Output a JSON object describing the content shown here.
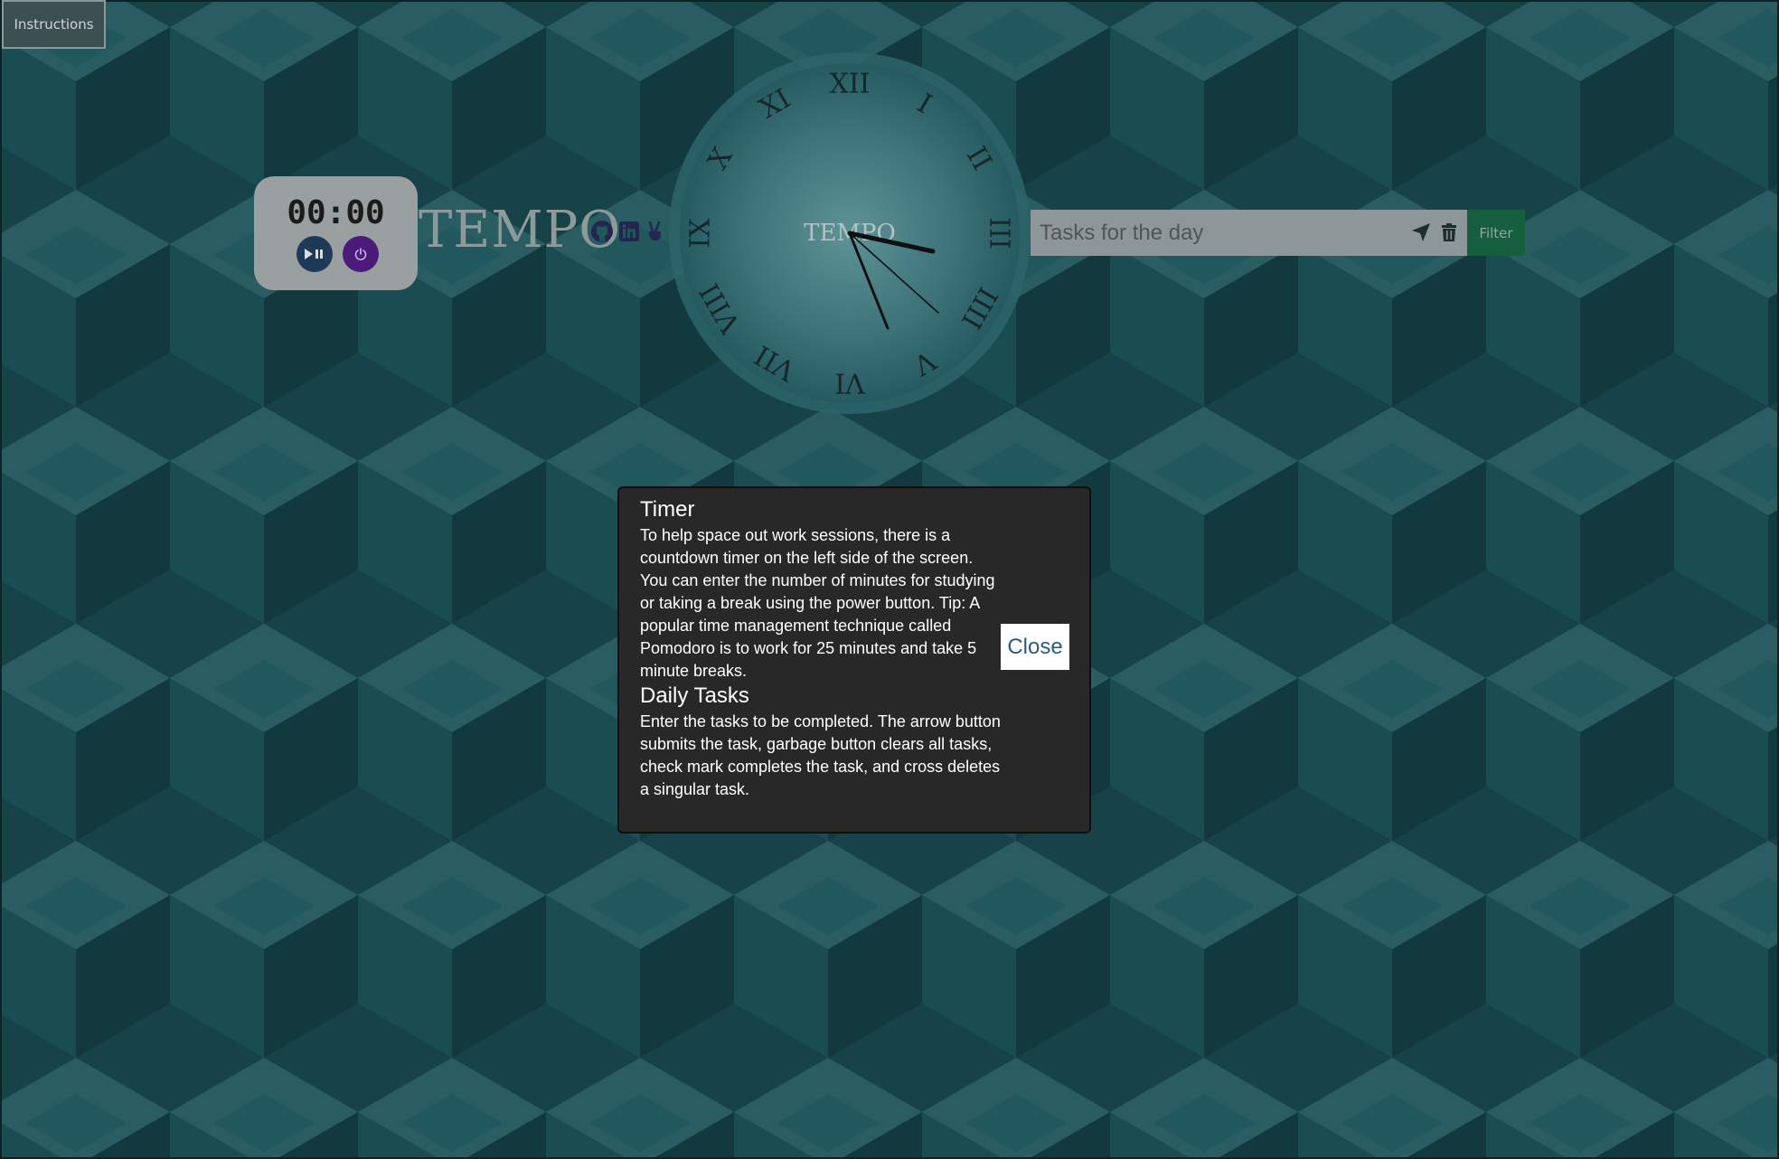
{
  "header": {
    "instructions_label": "Instructions"
  },
  "timer": {
    "display": "00:00",
    "play_icon": "play-pause-icon",
    "power_icon": "power-icon"
  },
  "brand": {
    "title": "TEMPO"
  },
  "social": [
    "github-icon",
    "linkedin-icon",
    "peace-icon"
  ],
  "clock": {
    "face_label": "TEMPO",
    "numerals": [
      "XII",
      "I",
      "II",
      "III",
      "IIII",
      "V",
      "VI",
      "VII",
      "VIII",
      "IX",
      "X",
      "XI"
    ]
  },
  "tasks": {
    "placeholder": "Tasks for the day",
    "submit_icon": "arrow-icon",
    "clear_icon": "trash-icon",
    "filter_label": "Filter"
  },
  "modal": {
    "timer_heading": "Timer",
    "timer_text": "To help space out work sessions, there is a countdown timer on the left side of the screen. You can enter the number of minutes for studying or taking a break using the power button. Tip: A popular time management technique called Pomodoro is to work for 25 minutes and take 5 minute breaks.",
    "tasks_heading": "Daily Tasks",
    "tasks_text": "Enter the tasks to be completed. The arrow button submits the task, garbage button clears all tasks, check mark completes the task, and cross deletes a singular task.",
    "close_label": "Close"
  },
  "colors": {
    "background": "#21565c",
    "overlay": "#1b3e42",
    "filter": "#155e3e",
    "modal": "#282828"
  }
}
